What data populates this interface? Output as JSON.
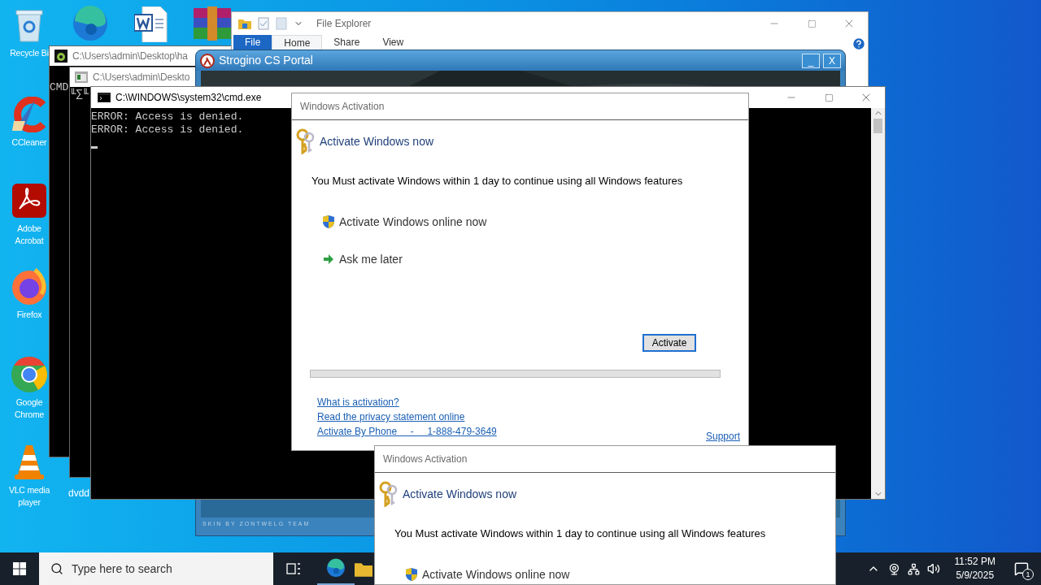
{
  "desktop_icons": [
    {
      "kind": "recycle",
      "label": "Recycle Bi"
    },
    {
      "kind": "ccleaner",
      "label": "CCleaner"
    },
    {
      "kind": "acrobat",
      "label": "Adobe Acrobat"
    },
    {
      "kind": "firefox",
      "label": "Firefox"
    },
    {
      "kind": "chrome",
      "label": "Google Chrome"
    },
    {
      "kind": "vlc",
      "label": "VLC media player"
    }
  ],
  "desktop_label": "dvdd",
  "back_windows": [
    {
      "title": "C:\\Users\\admin\\Desktop\\ha",
      "text": "CMD"
    },
    {
      "title": "C:\\Users\\admin\\Deskto",
      "text": "╙∑╙"
    }
  ],
  "file_explorer": {
    "title": "File Explorer",
    "tabs": [
      {
        "kind": "menu",
        "label": "File",
        "selected": false
      },
      {
        "kind": "tab",
        "label": "Home",
        "selected": true
      },
      {
        "kind": "tab",
        "label": "Share",
        "selected": false
      },
      {
        "kind": "tab",
        "label": "View",
        "selected": false
      }
    ]
  },
  "portal": {
    "title": "Strogino CS Portal",
    "minimize": "_",
    "close": "X",
    "footer": "SKIN BY ZONTWELG TEAM"
  },
  "console": {
    "title": "C:\\WINDOWS\\system32\\cmd.exe",
    "lines": [
      "ERROR: Access is denied.",
      "ERROR: Access is denied."
    ]
  },
  "activation_dialogs": [
    {
      "title": "Windows Activation",
      "heading": "Activate Windows now",
      "message": "You Must activate Windows within 1 day to continue using all Windows features",
      "options": [
        {
          "kind": "shield",
          "label": "Activate Windows online now"
        },
        {
          "kind": "arrow",
          "label": "Ask me later"
        }
      ],
      "button": "Activate",
      "progress": {
        "level": 0
      },
      "links": [
        "What is activation?",
        "Read the privacy statement online",
        "Activate By Phone     -     1-888-479-3649"
      ],
      "support": "Support"
    },
    {
      "title": "Windows Activation",
      "heading": "Activate Windows now",
      "message": "You Must activate Windows within 1 day to continue using all Windows features",
      "options": [
        {
          "kind": "shield",
          "label": "Activate Windows online now"
        }
      ]
    }
  ],
  "taskbar": {
    "search_placeholder": "Type here to search",
    "time": "11:52 PM",
    "date": "5/9/2025",
    "notification_count": "1"
  }
}
